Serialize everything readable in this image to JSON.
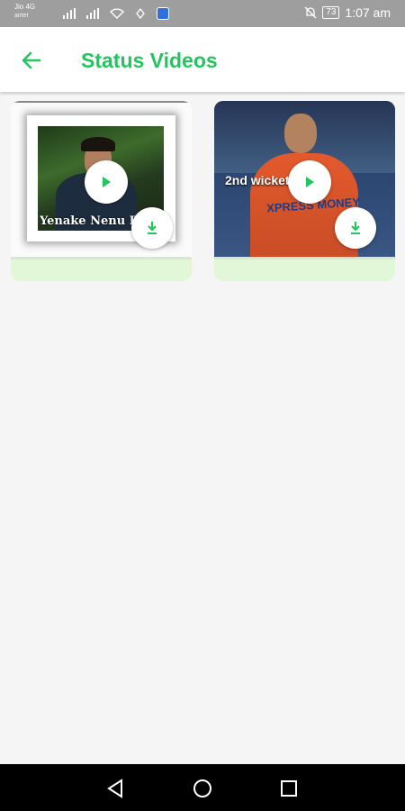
{
  "status_bar": {
    "carrier_line1": "Jio 4G",
    "carrier_line2": "airtel",
    "time": "1:07 am",
    "battery": "73"
  },
  "app_bar": {
    "title": "Status Videos",
    "back_icon": "arrow-left-icon"
  },
  "videos": [
    {
      "caption": "Yenake Nenu Ra",
      "play_icon": "play-icon",
      "download_icon": "download-icon"
    },
    {
      "caption": "2nd wicket",
      "jersey_text": "XPRESS MONEY",
      "play_icon": "play-icon",
      "download_icon": "download-icon"
    }
  ],
  "nav_bar": {
    "back_icon": "triangle-back-icon",
    "home_icon": "circle-home-icon",
    "recents_icon": "square-recents-icon"
  },
  "colors": {
    "accent": "#22c55e",
    "card_bg": "#e2f7d8",
    "status_bar": "#9e9e9e"
  }
}
